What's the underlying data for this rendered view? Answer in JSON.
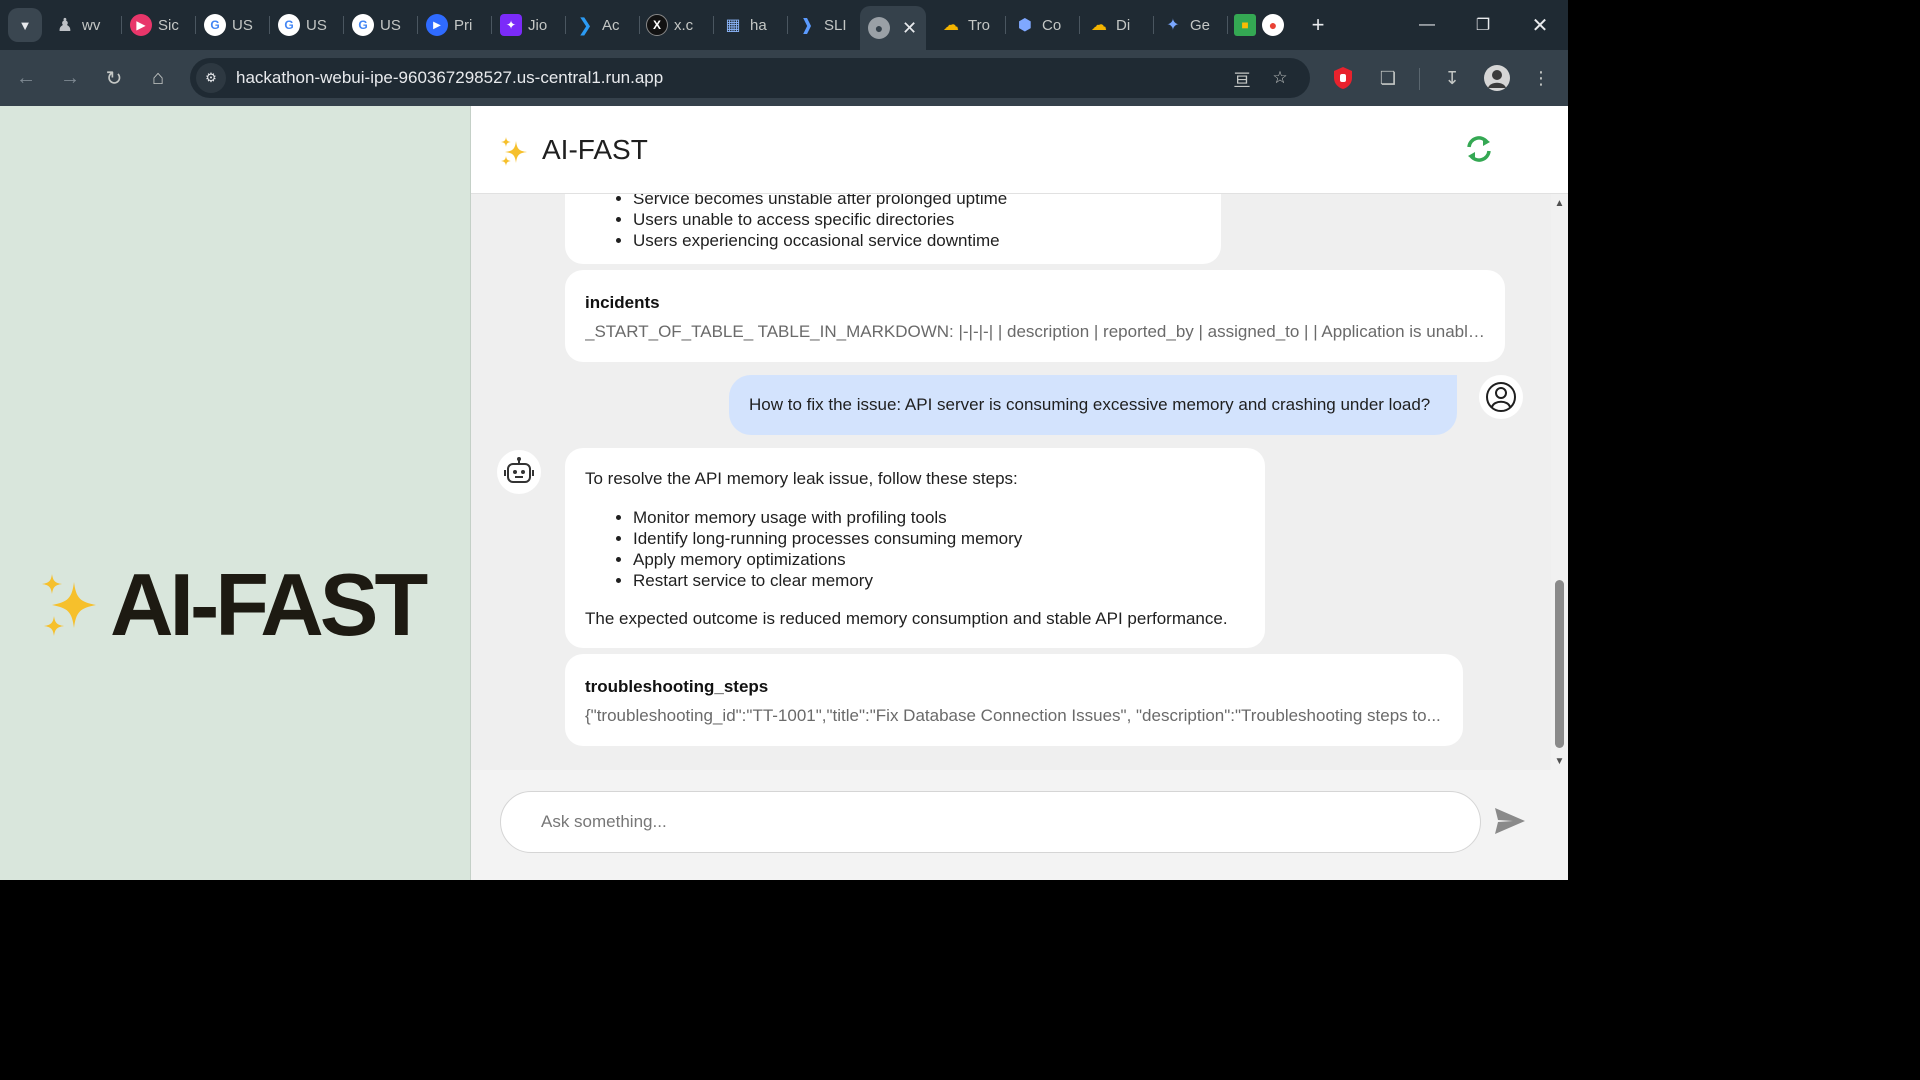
{
  "browser": {
    "tabs": [
      {
        "label": "wv",
        "icon": "pawn-icon",
        "color": "#bdc1c6"
      },
      {
        "label": "Sic",
        "icon": "play-icon",
        "color": "#e8366a"
      },
      {
        "label": "US",
        "icon": "google-icon",
        "color": "#ffffff"
      },
      {
        "label": "US",
        "icon": "google-icon",
        "color": "#ffffff"
      },
      {
        "label": "US",
        "icon": "google-icon",
        "color": "#ffffff"
      },
      {
        "label": "Pri",
        "icon": "play-circle-icon",
        "color": "#2f6bff"
      },
      {
        "label": "Jio",
        "icon": "jio-icon",
        "color": "#7b2bf9"
      },
      {
        "label": "Ac",
        "icon": "vscode-icon",
        "color": "#2b9bf4"
      },
      {
        "label": "x.c",
        "icon": "x-icon",
        "color": "#111111"
      },
      {
        "label": "ha",
        "icon": "grid-icon",
        "color": "#8ab4f8"
      },
      {
        "label": "SLI",
        "icon": "chevrons-icon",
        "color": "#5b9bff"
      },
      {
        "label": "",
        "icon": "globe-icon",
        "color": "#c4c7c5"
      },
      {
        "label": "Tro",
        "icon": "cloud-icon",
        "color": "#f4b400"
      },
      {
        "label": "Co",
        "icon": "hexagon-icon",
        "color": "#7fa8ff"
      },
      {
        "label": "Di",
        "icon": "cloud-icon",
        "color": "#f4b400"
      },
      {
        "label": "Ge",
        "icon": "gemini-star-icon",
        "color": "#7aa7ff"
      },
      {
        "label": "",
        "icon": "record-icon",
        "color": "#e94235"
      }
    ],
    "url": "hackathon-webui-ipe-960367298527.us-central1.run.app"
  },
  "app": {
    "name": "AI-FAST",
    "header_title": "AI-FAST",
    "colors": {
      "accent": "#f6c02c",
      "refresh": "#34a853",
      "user_bubble": "#d3e3fd",
      "left_panel": "#d9e6dc"
    }
  },
  "messages": {
    "first_list": {
      "cut_item": "Service becomes unstable after prolonged uptime",
      "items": [
        "Users unable to access specific directories",
        "Users experiencing occasional service downtime"
      ]
    },
    "source_incidents": {
      "title": "incidents",
      "snippet": "_START_OF_TABLE_ TABLE_IN_MARKDOWN: |-|-|-| | description | reported_by | assigned_to | | Application is unable to..."
    },
    "user_question": "How to fix the issue: API server is consuming excessive memory and crashing under load?",
    "bot_answer": {
      "intro": "To resolve the API memory leak issue, follow these steps:",
      "steps": [
        "Monitor memory usage with profiling tools",
        "Identify long-running processes consuming memory",
        "Apply memory optimizations",
        "Restart service to clear memory"
      ],
      "outcome": "The expected outcome is reduced memory consumption and stable API performance."
    },
    "source_troubleshooting": {
      "title": "troubleshooting_steps",
      "snippet": "{\"troubleshooting_id\":\"TT-1001\",\"title\":\"Fix Database Connection Issues\", \"description\":\"Troubleshooting steps to..."
    }
  },
  "input": {
    "placeholder": "Ask something..."
  }
}
